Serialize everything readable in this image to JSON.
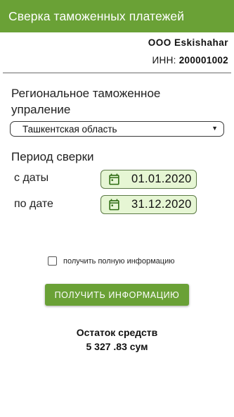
{
  "appbar": {
    "title": "Сверка таможенных платежей",
    "color": "#6aa136"
  },
  "company": {
    "name": "ООО Eskishahar",
    "inn_label": "ИНН: ",
    "inn_value": "200001002"
  },
  "region": {
    "label": "Региональное таможенное упраление",
    "selected": "Ташкентская область",
    "dropdown_icon": "triangle-down-icon"
  },
  "period": {
    "label": "Период сверки",
    "from_label": "с даты",
    "from_value": "01.01.2020",
    "to_label": "по дате",
    "to_value": "31.12.2020",
    "icon": "calendar-icon",
    "field_bg": "#e6f6d4"
  },
  "full_info": {
    "label": "получить полную информацию",
    "checked": false
  },
  "action": {
    "button_label": "ПОЛУЧИТЬ ИНФОРМАЦИЮ"
  },
  "balance": {
    "label": "Остаток средств",
    "value": "5 327 .83  сум"
  }
}
